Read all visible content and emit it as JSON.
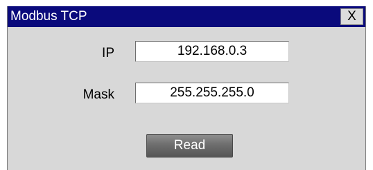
{
  "dialog": {
    "title": "Modbus TCP",
    "close_label": "X"
  },
  "form": {
    "ip_label": "IP",
    "ip_value": "192.168.0.3",
    "mask_label": "Mask",
    "mask_value": "255.255.255.0",
    "read_label": "Read"
  },
  "colors": {
    "titlebar": "#0a0a7c",
    "panel": "#d8d8d8",
    "button": "#6e6e6e"
  }
}
